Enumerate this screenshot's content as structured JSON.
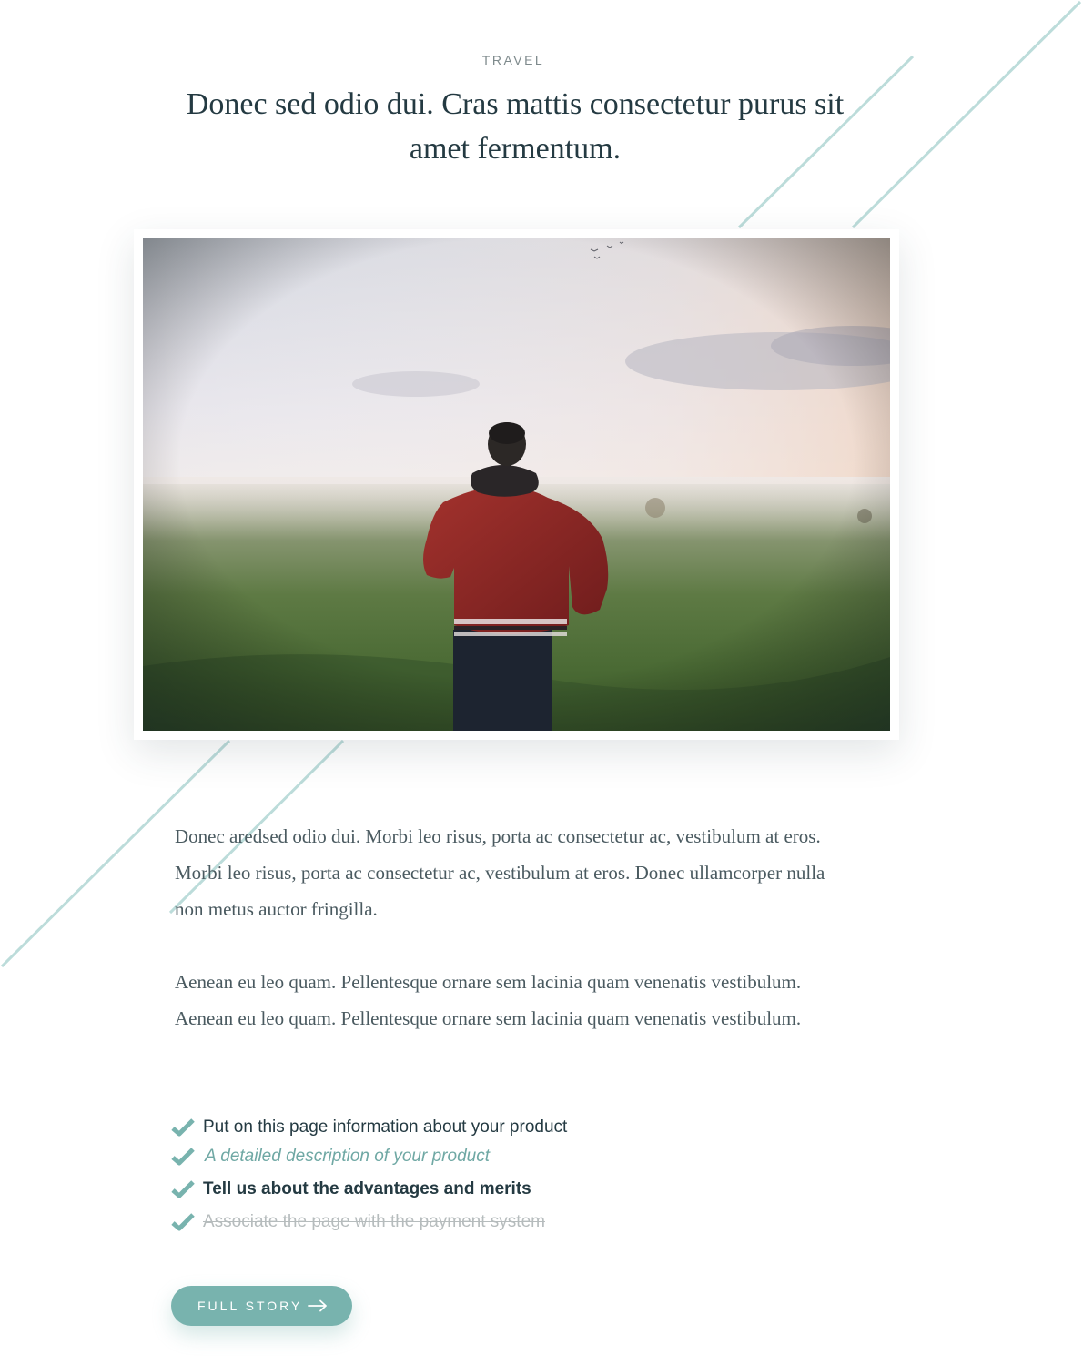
{
  "article": {
    "category": "TRAVEL",
    "title": "Donec sed odio dui. Cras mattis consectetur purus sit amet fermentum.",
    "image": {
      "alt": "Man in red jacket standing in a misty green field"
    },
    "paragraphs": [
      "Donec aredsed odio dui. Morbi leo risus, porta ac consectetur ac, vestibulum at eros. Morbi leo risus, porta ac consectetur ac, vestibulum at eros. Donec ullamcorper nulla non metus auctor fringilla.",
      "Aenean eu leo quam. Pellentesque ornare sem lacinia quam venenatis vestibulum. Aenean eu leo quam. Pellentesque ornare sem lacinia quam venenatis vestibulum."
    ],
    "checklist": [
      {
        "text": "Put on this page information about your product",
        "style": "regular"
      },
      {
        "text": "A detailed description of your product",
        "style": "italic-accent"
      },
      {
        "text": "Tell us about the advantages and merits",
        "style": "bold"
      },
      {
        "text": "Associate the page with the payment system",
        "style": "strikethrough"
      }
    ],
    "cta": {
      "label": "FULL STORY",
      "icon": "arrow-right-icon"
    }
  },
  "icons": {
    "check": "checkmark-icon",
    "arrow": "arrow-right-icon"
  },
  "colors": {
    "accent": "#78b3ae",
    "decor_line": "#bcdcda",
    "heading": "#243a42",
    "body_text": "#4a5a60",
    "muted": "#b6bcbd"
  }
}
